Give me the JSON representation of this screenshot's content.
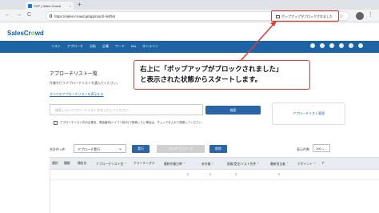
{
  "browser": {
    "tab_title": "TOP | Sales Crowd",
    "new_tab": "+",
    "tab_close": "×",
    "nav_back": "←",
    "nav_forward": "→",
    "nav_reload": "C",
    "url": "https://sales-crowd.jp/approach-list/list",
    "popup_blocked": "ポップアップがブロックされました",
    "star": "☆",
    "menu": "⋮"
  },
  "app": {
    "logo_main": "SalesCr",
    "logo_accent": "o",
    "logo_end": "wd",
    "nav": [
      "リスト",
      "アプローチ",
      "分析",
      "企業",
      "ワード",
      "MA",
      "オンライン"
    ]
  },
  "page": {
    "title": "アプローチリスト一覧",
    "description": "作業を行うアプローチリストを選んでください。",
    "link": "すべてのアプローチリストを表示する",
    "search_placeholder": "検索したいアプローチリスト名を入力してください",
    "search_button": "検索",
    "manage_button": "アプローチリスト管理",
    "check_label": "アプローチリスト内の企業名、電話番号(ハイフン除き)で検索したい場合は、チェックを入れて検索してください",
    "bulk_label": "合計件 n件",
    "bulk_select": "アプローチ実行",
    "bulk_chevron": "⌄",
    "exec_button": "実行",
    "csv_button": "CSVダウンロード",
    "delete_button": "削除",
    "per_page_label": "表示件数",
    "per_page_value": "100 ⌄"
  },
  "table": {
    "headers": [
      "選択",
      "種類",
      "開封名",
      "アプローチリスト名 ⌃",
      "アラーミングテ",
      "最終作業日時 ⌃",
      "未作業 ⌃",
      "既報/受注/リスト先件 ⌃",
      "最新担当者 ⌃",
      "アポイント ⌃",
      "ア"
    ],
    "row": [
      "0",
      "0",
      "0",
      "0"
    ]
  },
  "callout": {
    "line1": "右上に「ポップアップがブロックされました」",
    "line2": "と表示された状態からスタートします。"
  },
  "colors": {
    "accent": "#1e63a4",
    "highlight": "#e53935",
    "logo_green": "#7cc242"
  }
}
